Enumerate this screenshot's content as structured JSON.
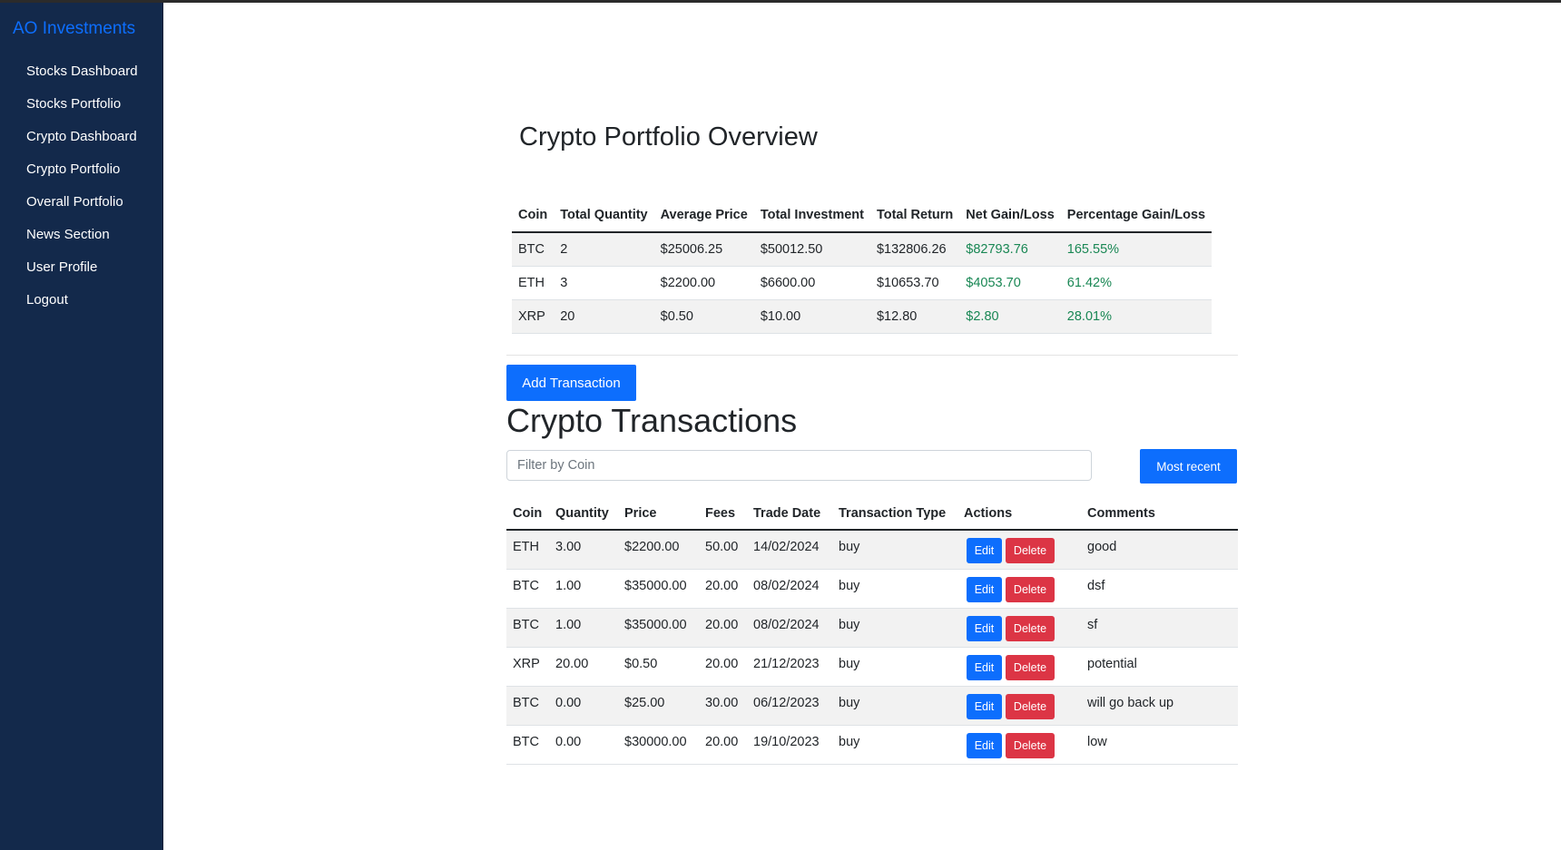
{
  "sidebar": {
    "brand": "AO Investments",
    "items": [
      {
        "label": "Stocks Dashboard"
      },
      {
        "label": "Stocks Portfolio"
      },
      {
        "label": "Crypto Dashboard"
      },
      {
        "label": "Crypto Portfolio"
      },
      {
        "label": "Overall Portfolio"
      },
      {
        "label": "News Section"
      },
      {
        "label": "User Profile"
      },
      {
        "label": "Logout"
      }
    ]
  },
  "overview": {
    "title": "Crypto Portfolio Overview",
    "columns": [
      "Coin",
      "Total Quantity",
      "Average Price",
      "Total Investment",
      "Total Return",
      "Net Gain/Loss",
      "Percentage Gain/Loss"
    ],
    "rows": [
      {
        "coin": "BTC",
        "quantity": "2",
        "avg_price": "$25006.25",
        "investment": "$50012.50",
        "return": "$132806.26",
        "net": "$82793.76",
        "pct": "165.55%"
      },
      {
        "coin": "ETH",
        "quantity": "3",
        "avg_price": "$2200.00",
        "investment": "$6600.00",
        "return": "$10653.70",
        "net": "$4053.70",
        "pct": "61.42%"
      },
      {
        "coin": "XRP",
        "quantity": "20",
        "avg_price": "$0.50",
        "investment": "$10.00",
        "return": "$12.80",
        "net": "$2.80",
        "pct": "28.01%"
      }
    ],
    "gain_color": "#198754"
  },
  "transactions": {
    "add_label": "Add Transaction",
    "title": "Crypto Transactions",
    "filter_placeholder": "Filter by Coin",
    "filter_value": "",
    "sort_label": "Most recent",
    "edit_label": "Edit",
    "delete_label": "Delete",
    "columns": [
      "Coin",
      "Quantity",
      "Price",
      "Fees",
      "Trade Date",
      "Transaction Type",
      "Actions",
      "Comments"
    ],
    "rows": [
      {
        "coin": "ETH",
        "quantity": "3.00",
        "price": "$2200.00",
        "fees": "50.00",
        "date": "14/02/2024",
        "type": "buy",
        "comment": "good"
      },
      {
        "coin": "BTC",
        "quantity": "1.00",
        "price": "$35000.00",
        "fees": "20.00",
        "date": "08/02/2024",
        "type": "buy",
        "comment": "dsf"
      },
      {
        "coin": "BTC",
        "quantity": "1.00",
        "price": "$35000.00",
        "fees": "20.00",
        "date": "08/02/2024",
        "type": "buy",
        "comment": "sf"
      },
      {
        "coin": "XRP",
        "quantity": "20.00",
        "price": "$0.50",
        "fees": "20.00",
        "date": "21/12/2023",
        "type": "buy",
        "comment": "potential"
      },
      {
        "coin": "BTC",
        "quantity": "0.00",
        "price": "$25.00",
        "fees": "30.00",
        "date": "06/12/2023",
        "type": "buy",
        "comment": "will go back up"
      },
      {
        "coin": "BTC",
        "quantity": "0.00",
        "price": "$30000.00",
        "fees": "20.00",
        "date": "19/10/2023",
        "type": "buy",
        "comment": "low"
      }
    ]
  },
  "colors": {
    "sidebar_bg": "#13294b",
    "brand": "#0d6efd",
    "primary": "#0d6efd",
    "danger": "#dc3545",
    "gain": "#198754"
  }
}
